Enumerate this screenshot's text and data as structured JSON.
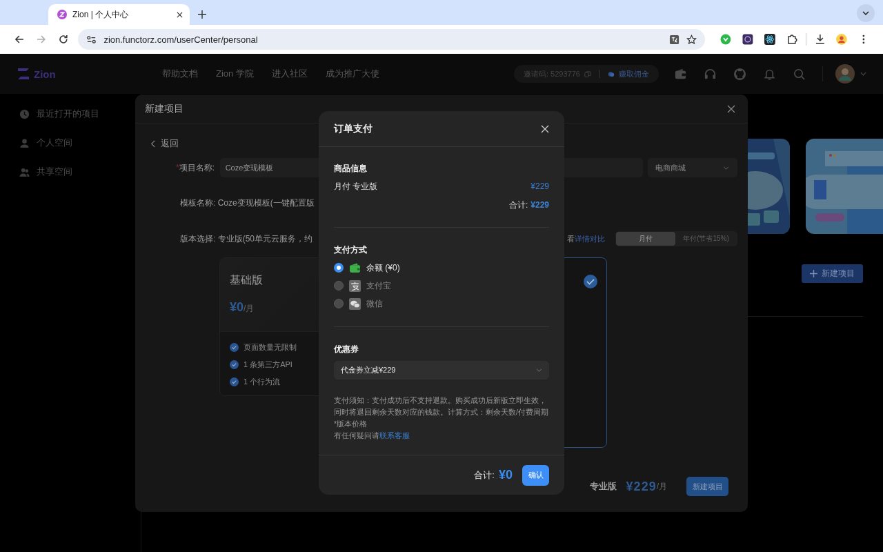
{
  "browser": {
    "tabs": [
      {
        "title": "Zion | 个人中心",
        "selected": true
      }
    ],
    "url": "zion.functorz.com/userCenter/personal",
    "forward_disabled": true
  },
  "header": {
    "logo": "Zion",
    "nav": [
      "帮助文档",
      "Zion 学院",
      "进入社区",
      "成为推广大使"
    ],
    "invite_code": "邀请码: 5293776",
    "earn_link": "赚取佣金"
  },
  "sidebar": {
    "items": [
      {
        "label": "最近打开的项目",
        "kind": "recent",
        "selected": false
      },
      {
        "label": "个人空间",
        "kind": "personal",
        "selected": false
      },
      {
        "label": "共享空间",
        "kind": "shared",
        "selected": false
      }
    ]
  },
  "content": {
    "new_project_button": "新建项目"
  },
  "new_project_modal": {
    "title": "新建项目",
    "back": "返回",
    "required_mark": "*",
    "name_label": "项目名称:",
    "name_value": "Coze变现模板",
    "category": "电商商城",
    "template_line": "模板名称: Coze变现模板(一键配置版",
    "version_line": "版本选择: 专业版(50单元云服务，约",
    "compare_prefix": "看",
    "compare_link": "详情对比",
    "billing": [
      {
        "label": "月付",
        "selected": true
      },
      {
        "label": "年付(节省15%)",
        "selected": false
      }
    ],
    "plans": [
      {
        "name": "基础版",
        "price": "¥0",
        "unit": "/月",
        "features": [
          "页面数量无限制",
          "1 条第三方API",
          "1 个行为流"
        ],
        "selected": false
      },
      {
        "selected": true
      }
    ],
    "footer": {
      "plan": "专业版",
      "price": "¥229",
      "unit": "/月",
      "button": "新建项目"
    }
  },
  "payment_dialog": {
    "title": "订单支付",
    "product_heading": "商品信息",
    "item": "月付 专业版",
    "item_price": "¥229",
    "subtotal_label": "合计:",
    "subtotal": "¥229",
    "method_heading": "支付方式",
    "methods": [
      {
        "kind": "balance",
        "label": "余额 (¥0)",
        "selected": true
      },
      {
        "kind": "alipay",
        "label": "支付宝",
        "selected": false
      },
      {
        "kind": "wechat",
        "label": "微信",
        "selected": false
      }
    ],
    "coupon_heading": "优惠券",
    "coupon": "代金券立减¥229",
    "notice": "支付须知：支付成功后不支持退款。购买成功后新版立即生效，同时将退回剩余天数对应的钱款。计算方式：剩余天数/付费周期*版本价格",
    "help": "有任何疑问请",
    "help_link": "联系客服",
    "total_label": "合计:",
    "total": "¥0",
    "confirm": "确认"
  }
}
